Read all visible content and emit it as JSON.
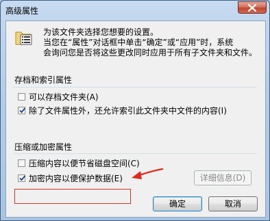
{
  "window": {
    "title": "高级属性"
  },
  "description": {
    "line1": "为该文件夹选择您想要的设置。",
    "line2": "当您在“属性”对话框中单击“确定”或“应用”时，系统",
    "line3": "会询问您是否将这些更改同时应用于所有子文件夹和文件。"
  },
  "archive_group": {
    "title": "存档和索引属性",
    "items": [
      {
        "label": "可以存档文件夹(A)",
        "checked": false
      },
      {
        "label": "除了文件属性外，还允许索引此文件夹中文件的内容(I)",
        "checked": true
      }
    ]
  },
  "compress_group": {
    "title": "压缩或加密属性",
    "items": [
      {
        "label": "压缩内容以便节省磁盘空间(C)",
        "checked": false
      },
      {
        "label": "加密内容以便保护数据(E)",
        "checked": true
      }
    ],
    "details_label": "详细信息(D)"
  },
  "buttons": {
    "ok": "确定",
    "cancel": "取消"
  },
  "colors": {
    "highlight": "#d8332a",
    "arrow": "#e02a1f"
  },
  "icons": {
    "folder": "folder-properties-icon",
    "close": "close-icon",
    "arrow": "arrow-annotation-icon"
  }
}
